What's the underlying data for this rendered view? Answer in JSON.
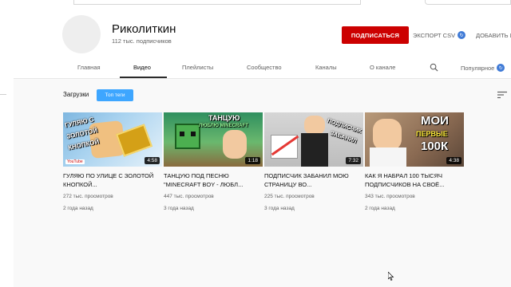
{
  "channel": {
    "name": "Риколиткин",
    "subscribers": "112 тыс. подписчиков",
    "subscribe_label": "ПОДПИСАТЬСЯ",
    "export_label": "ЭКСПОРТ CSV",
    "add_label": "ДОБАВИТЬ И"
  },
  "tabs": [
    {
      "label": "Главная"
    },
    {
      "label": "Видео"
    },
    {
      "label": "Плейлисты"
    },
    {
      "label": "Сообщество"
    },
    {
      "label": "Каналы"
    },
    {
      "label": "О канале"
    }
  ],
  "active_tab": "Видео",
  "sort_label": "Популярное",
  "section": {
    "title": "Загрузки",
    "chip_label": "Топ теги"
  },
  "videos": [
    {
      "title": "ГУЛЯЮ ПО УЛИЦЕ С ЗОЛОТОЙ КНОПКОЙ...",
      "views": "272 тыс. просмотров",
      "age": "2 года назад",
      "duration": "4:58",
      "thumb_text_1": "ГУЛЯЮ С",
      "thumb_text_2": "ЗОЛОТОЙ",
      "thumb_text_3": "КНОПКОЙ",
      "thumb_corner": "YouTube"
    },
    {
      "title": "ТАНЦУЮ ПОД ПЕСНЮ \"MINECRAFT BOY - ЛЮБЛ...",
      "views": "447 тыс. просмотров",
      "age": "3 года назад",
      "duration": "1:18",
      "thumb_text_1": "ТАНЦУЮ",
      "thumb_text_2": "ЛЮБЛЮ MINECRAFT"
    },
    {
      "title": "ПОДПИСЧИК ЗАБАНИЛ МОЮ СТРАНИЦУ ВО...",
      "views": "225 тыс. просмотров",
      "age": "3 года назад",
      "duration": "7:32",
      "thumb_text_1": "ПОДПИСЧИК",
      "thumb_text_2": "ЗАБАНИЛ"
    },
    {
      "title": "КАК Я НАБРАЛ 100 ТЫСЯЧ ПОДПИСЧИКОВ НА СВОЁ...",
      "views": "343 тыс. просмотров",
      "age": "2 года назад",
      "duration": "4:38",
      "thumb_text_1": "МОИ",
      "thumb_text_2": "ПЕРВЫЕ",
      "thumb_text_3": "100К"
    }
  ],
  "colors": {
    "subscribe": "#cc0000",
    "chip": "#3ea6ff",
    "badge": "#3f7ad6"
  },
  "icons": [
    "search-icon",
    "sort-icon",
    "badge-icon",
    "cursor-icon"
  ]
}
